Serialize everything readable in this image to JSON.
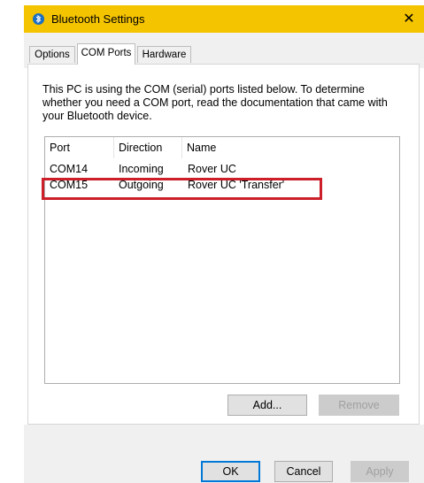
{
  "window": {
    "title": "Bluetooth Settings",
    "close_glyph": "✕",
    "title_bar_color": "#f5c400"
  },
  "tabs": [
    {
      "label": "Options",
      "selected": false
    },
    {
      "label": "COM Ports",
      "selected": true
    },
    {
      "label": "Hardware",
      "selected": false
    }
  ],
  "com_ports": {
    "description": "This PC is using the COM (serial) ports listed below. To determine whether you need a COM port, read the documentation that came with your Bluetooth device.",
    "columns": [
      "Port",
      "Direction",
      "Name"
    ],
    "rows": [
      {
        "port": "COM14",
        "direction": "Incoming",
        "name": "Rover UC"
      },
      {
        "port": "COM15",
        "direction": "Outgoing",
        "name": "Rover UC 'Transfer'"
      }
    ],
    "highlight_color": "#cc1f2a",
    "add_label": "Add...",
    "remove_label": "Remove"
  },
  "footer": {
    "ok_label": "OK",
    "cancel_label": "Cancel",
    "apply_label": "Apply"
  }
}
